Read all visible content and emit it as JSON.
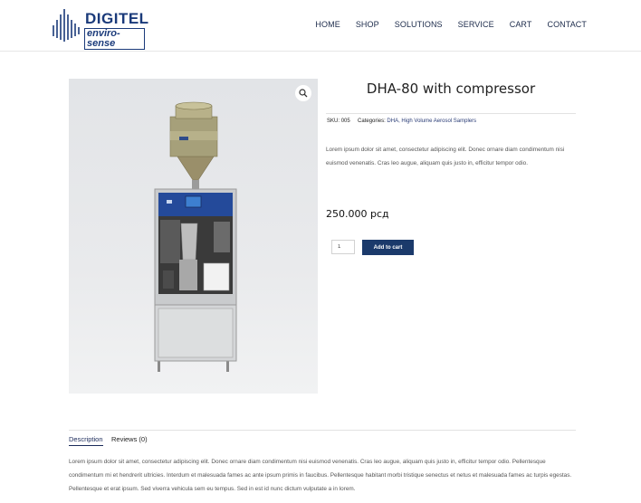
{
  "brand": {
    "name": "DIGITEL",
    "tagline": "enviro-sense"
  },
  "nav": [
    "HOME",
    "SHOP",
    "SOLUTIONS",
    "SERVICE",
    "CART",
    "CONTACT"
  ],
  "product": {
    "title": "DHA-80 with compressor",
    "sku_label": "SKU:",
    "sku": "005",
    "categories_label": "Categories:",
    "categories": "DHA, High Volume Aerosol Samplers",
    "short_description": "Lorem ipsum dolor sit amet, consectetur adipiscing elit. Donec ornare diam condimentum nisi euismod venenatis. Cras leo augue, aliquam quis justo in, efficitur tempor odio.",
    "price": "250.000 рсд",
    "quantity": "1",
    "add_to_cart": "Add to cart"
  },
  "tabs": [
    {
      "label": "Description"
    },
    {
      "label": "Reviews (0)"
    }
  ],
  "long_description": "Lorem ipsum dolor sit amet, consectetur adipiscing elit. Donec ornare diam condimentum nisi euismod venenatis. Cras leo augue, aliquam quis justo in, efficitur tempor odio. Pellentesque condimentum mi et hendrerit ultricies. Interdum et malesuada fames ac ante ipsum primis in faucibus. Pellentesque habitant morbi tristique senectus et netus et malesuada fames ac turpis egestas. Pellentesque et erat ipsum. Sed viverra vehicula sem eu tempus. Sed in est id nunc dictum vulputate a in lorem.",
  "icons": {
    "zoom": "magnifier-icon",
    "logo": "skyline-logo-icon"
  },
  "colors": {
    "brand": "#1a3a7a",
    "button": "#1b3a6b"
  }
}
